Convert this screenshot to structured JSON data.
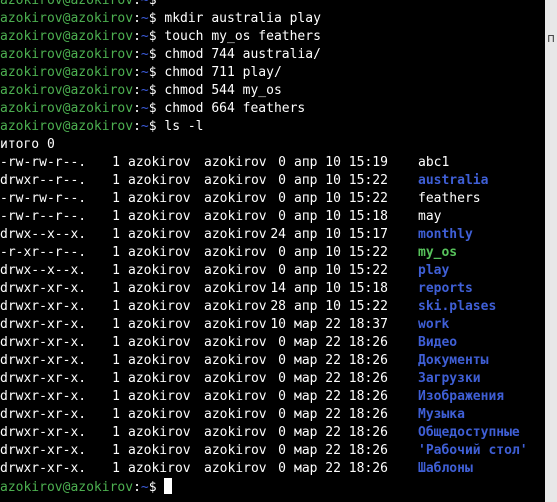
{
  "prompt": {
    "user": "azokirov@azokirov",
    "sep": ":",
    "path": "~",
    "dollar": "$"
  },
  "history": [
    {
      "cmd": ""
    },
    {
      "cmd": "mkdir australia play"
    },
    {
      "cmd": "touch my_os feathers"
    },
    {
      "cmd": "chmod 744 australia/"
    },
    {
      "cmd": "chmod 711 play/"
    },
    {
      "cmd": "chmod 544 my_os"
    },
    {
      "cmd": "chmod 664 feathers"
    },
    {
      "cmd": "ls -l"
    }
  ],
  "total_line": "итого 0",
  "listing": [
    {
      "perms": "-rw-rw-r--.",
      "links": "1",
      "owner": "azokirov",
      "group": "azokirov",
      "size": "0",
      "date": "апр 10 15:19",
      "name": "abc1",
      "type": "regular"
    },
    {
      "perms": "drwxr--r--.",
      "links": "1",
      "owner": "azokirov",
      "group": "azokirov",
      "size": "0",
      "date": "апр 10 15:22",
      "name": "australia",
      "type": "dir"
    },
    {
      "perms": "-rw-rw-r--.",
      "links": "1",
      "owner": "azokirov",
      "group": "azokirov",
      "size": "0",
      "date": "апр 10 15:22",
      "name": "feathers",
      "type": "regular"
    },
    {
      "perms": "-rw-r--r--.",
      "links": "1",
      "owner": "azokirov",
      "group": "azokirov",
      "size": "0",
      "date": "апр 10 15:18",
      "name": "may",
      "type": "regular"
    },
    {
      "perms": "drwx--x--x.",
      "links": "1",
      "owner": "azokirov",
      "group": "azokirov",
      "size": "24",
      "date": "апр 10 15:17",
      "name": "monthly",
      "type": "dir"
    },
    {
      "perms": "-r-xr--r--.",
      "links": "1",
      "owner": "azokirov",
      "group": "azokirov",
      "size": "0",
      "date": "апр 10 15:22",
      "name": "my_os",
      "type": "exec"
    },
    {
      "perms": "drwx--x--x.",
      "links": "1",
      "owner": "azokirov",
      "group": "azokirov",
      "size": "0",
      "date": "апр 10 15:22",
      "name": "play",
      "type": "dir"
    },
    {
      "perms": "drwxr-xr-x.",
      "links": "1",
      "owner": "azokirov",
      "group": "azokirov",
      "size": "14",
      "date": "апр 10 15:18",
      "name": "reports",
      "type": "dir"
    },
    {
      "perms": "drwxr-xr-x.",
      "links": "1",
      "owner": "azokirov",
      "group": "azokirov",
      "size": "28",
      "date": "апр 10 15:22",
      "name": "ski.plases",
      "type": "dir"
    },
    {
      "perms": "drwxr-xr-x.",
      "links": "1",
      "owner": "azokirov",
      "group": "azokirov",
      "size": "10",
      "date": "мар 22 18:37",
      "name": "work",
      "type": "dir"
    },
    {
      "perms": "drwxr-xr-x.",
      "links": "1",
      "owner": "azokirov",
      "group": "azokirov",
      "size": "0",
      "date": "мар 22 18:26",
      "name": "Видео",
      "type": "dir"
    },
    {
      "perms": "drwxr-xr-x.",
      "links": "1",
      "owner": "azokirov",
      "group": "azokirov",
      "size": "0",
      "date": "мар 22 18:26",
      "name": "Документы",
      "type": "dir"
    },
    {
      "perms": "drwxr-xr-x.",
      "links": "1",
      "owner": "azokirov",
      "group": "azokirov",
      "size": "0",
      "date": "мар 22 18:26",
      "name": "Загрузки",
      "type": "dir"
    },
    {
      "perms": "drwxr-xr-x.",
      "links": "1",
      "owner": "azokirov",
      "group": "azokirov",
      "size": "0",
      "date": "мар 22 18:26",
      "name": "Изображения",
      "type": "dir"
    },
    {
      "perms": "drwxr-xr-x.",
      "links": "1",
      "owner": "azokirov",
      "group": "azokirov",
      "size": "0",
      "date": "мар 22 18:26",
      "name": "Музыка",
      "type": "dir"
    },
    {
      "perms": "drwxr-xr-x.",
      "links": "1",
      "owner": "azokirov",
      "group": "azokirov",
      "size": "0",
      "date": "мар 22 18:26",
      "name": "Общедоступные",
      "type": "dir"
    },
    {
      "perms": "drwxr-xr-x.",
      "links": "1",
      "owner": "azokirov",
      "group": "azokirov",
      "size": "0",
      "date": "мар 22 18:26",
      "name": "'Рабочий стол'",
      "type": "dir"
    },
    {
      "perms": "drwxr-xr-x.",
      "links": "1",
      "owner": "azokirov",
      "group": "azokirov",
      "size": "0",
      "date": "мар 22 18:26",
      "name": "Шаблоны",
      "type": "dir"
    }
  ],
  "final_prompt": {
    "cmd": ""
  },
  "side_label": "П",
  "colors": {
    "background": "#000000",
    "prompt_user": "#4caf50",
    "prompt_path": "#3b5bdb",
    "dir": "#3f5fd6",
    "exec": "#57c25b",
    "text": "#ffffff"
  }
}
